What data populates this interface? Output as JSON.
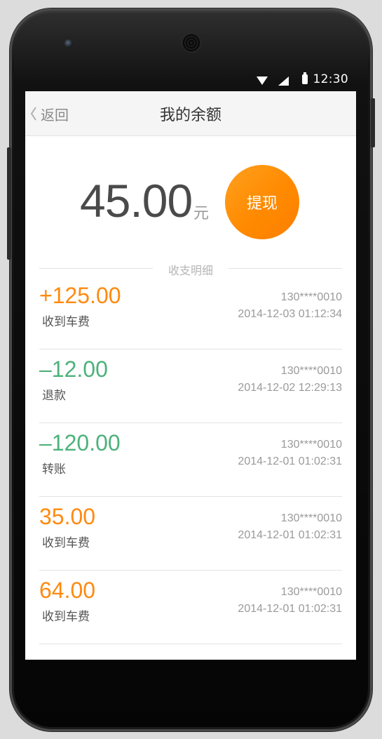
{
  "status_bar": {
    "time": "12:30"
  },
  "navbar": {
    "back_label": "返回",
    "title": "我的余额"
  },
  "balance": {
    "amount": "45.00",
    "unit": "元",
    "withdraw_label": "提现"
  },
  "section": {
    "label": "收支明细"
  },
  "transactions": [
    {
      "amount": "+125.00",
      "kind": "income",
      "type": "收到车费",
      "phone": "130****0010",
      "time": "2014-12-03 01:12:34"
    },
    {
      "amount": "–12.00",
      "kind": "expense",
      "type": "退款",
      "phone": "130****0010",
      "time": "2014-12-02 12:29:13"
    },
    {
      "amount": "–120.00",
      "kind": "expense",
      "type": "转账",
      "phone": "130****0010",
      "time": "2014-12-01 01:02:31"
    },
    {
      "amount": "35.00",
      "kind": "income",
      "type": "收到车费",
      "phone": "130****0010",
      "time": "2014-12-01 01:02:31"
    },
    {
      "amount": "64.00",
      "kind": "income",
      "type": "收到车费",
      "phone": "130****0010",
      "time": "2014-12-01 01:02:31"
    }
  ],
  "colors": {
    "accent": "#ff8a0f",
    "income": "#ff8a0f",
    "expense": "#4db27b"
  }
}
